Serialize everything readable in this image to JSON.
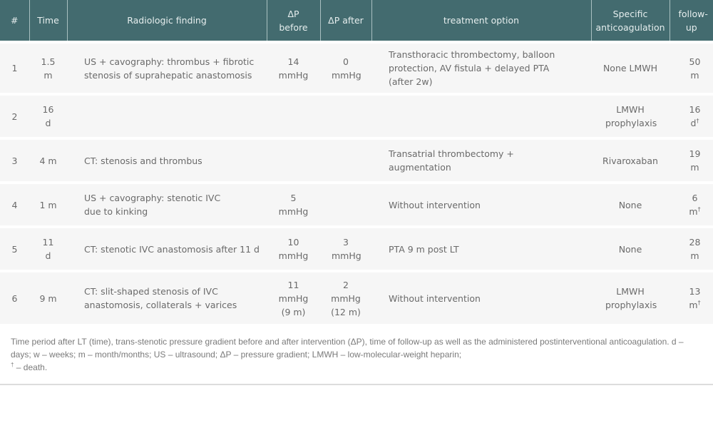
{
  "table": {
    "headers": [
      "#",
      "Time",
      "Radiologic finding",
      "ΔP before",
      "ΔP after",
      "treatment option",
      "Specific anticoagulation",
      "follow-up"
    ],
    "rows": [
      {
        "num": "1",
        "time": "1.5 m",
        "finding": "US + cavography: thrombus + fibrotic stenosis of suprahepatic anastomosis",
        "dp_before": "14 mmHg",
        "dp_after": "0 mmHg",
        "treatment": "Transthoracic thrombectomy, balloon protection, AV fistula + delayed PTA (after 2w)",
        "anticoagulation": "None LMWH",
        "followup": "50 m",
        "followup_death": ""
      },
      {
        "num": "2",
        "time": "16 d",
        "finding": "",
        "dp_before": "",
        "dp_after": "",
        "treatment": "",
        "anticoagulation": "LMWH prophylaxis",
        "followup": "16 d",
        "followup_death": "†"
      },
      {
        "num": "3",
        "time": "4 m",
        "finding": "CT: stenosis and thrombus",
        "dp_before": "",
        "dp_after": "",
        "treatment": "Transatrial thrombectomy + augmentation",
        "anticoagulation": "Rivaroxaban",
        "followup": "19 m",
        "followup_death": ""
      },
      {
        "num": "4",
        "time": "1 m",
        "finding": "US + cavography: stenotic IVC due to kinking",
        "dp_before": "5 mmHg",
        "dp_after": "",
        "treatment": "Without intervention",
        "anticoagulation": "None",
        "followup": "6 m",
        "followup_death": "†"
      },
      {
        "num": "5",
        "time": "11 d",
        "finding": "CT: stenotic IVC anastomosis after 11 d",
        "dp_before": "10 mmHg",
        "dp_after": "3 mmHg",
        "treatment": "PTA 9 m post LT",
        "anticoagulation": "None",
        "followup": "28 m",
        "followup_death": ""
      },
      {
        "num": "6",
        "time": "9 m",
        "finding": "CT: slit-shaped stenosis of IVC anastomosis, collaterals + varices",
        "dp_before": "11 mmHg (9 m)",
        "dp_after": "2 mmHg (12 m)",
        "treatment": "Without intervention",
        "anticoagulation": "LMWH prophylaxis",
        "followup": "13 m",
        "followup_death": "†"
      }
    ]
  },
  "footnote": {
    "line1": "Time period after LT (time), trans-stenotic pressure gradient before and after intervention (ΔP), time of follow-up as well as the administered postinterventional anticoagulation. d – days; w – weeks; m – month/months; US – ultrasound; ΔP – pressure gradient; LMWH – low-molecular-weight heparin;",
    "dagger": "†",
    "line2": " – death."
  }
}
